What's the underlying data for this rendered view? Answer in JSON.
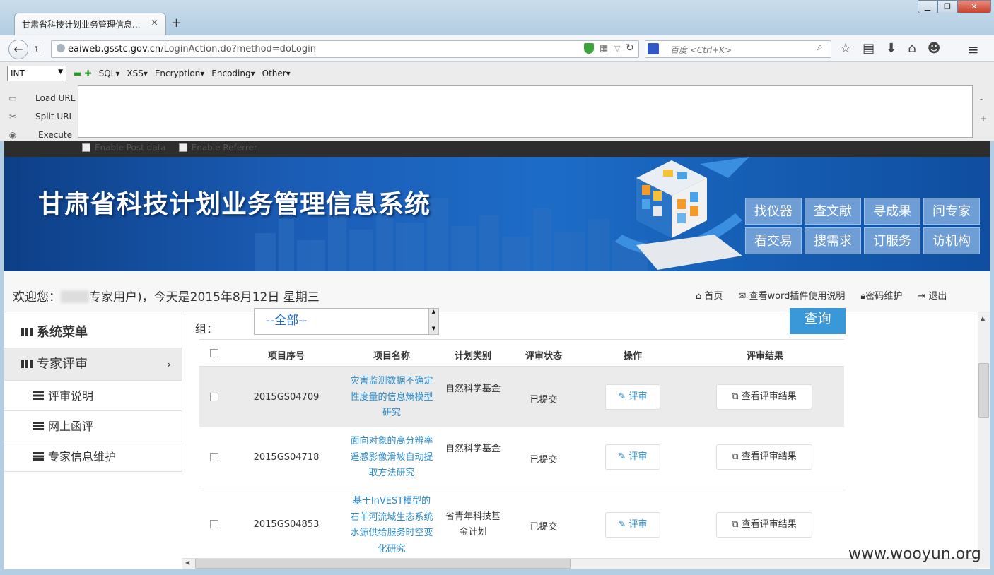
{
  "browser": {
    "tab_title": "甘肃省科技计划业务管理信息...",
    "tab_close": "×",
    "new_tab": "+",
    "url_host": "eaiweb.gsstc.gov.cn",
    "url_path": "/LoginAction.do?method=doLogin",
    "search_placeholder": "百度 <Ctrl+K>",
    "window_buttons": [
      "▁",
      "❐",
      "✕"
    ]
  },
  "hackbar": {
    "select_value": "INT",
    "menus": [
      "SQL▾",
      "XSS▾",
      "Encryption▾",
      "Encoding▾",
      "Other▾"
    ],
    "actions": [
      "Load URL",
      "Split URL",
      "Execute"
    ],
    "side_marks": [
      "-",
      "+"
    ],
    "post_option": "Enable Post data",
    "referrer_option": "Enable Referrer"
  },
  "banner": {
    "title": "甘肃省科技计划业务管理信息系统",
    "nav": [
      "找仪器",
      "查文献",
      "寻成果",
      "问专家",
      "看交易",
      "搜需求",
      "订服务",
      "访机构"
    ]
  },
  "welcome": {
    "prefix": "欢迎您：",
    "suffix": "专家用户)，今天是2015年8月12日 星期三",
    "links": [
      "首页",
      "查看word插件使用说明",
      "密码维护",
      "退出"
    ]
  },
  "sidebar": {
    "title": "系统菜单",
    "section": "专家评审",
    "items": [
      "评审说明",
      "网上函评",
      "专家信息维护"
    ]
  },
  "filter": {
    "group_label": "组：",
    "group_value": "--全部--",
    "query_button": "查询"
  },
  "table": {
    "headers": [
      "项目序号",
      "项目名称",
      "计划类别",
      "评审状态",
      "操作",
      "评审结果"
    ],
    "rows": [
      {
        "id": "2015GS04709",
        "name": "灾害监测数据不确定性度量的信息熵模型研究",
        "type": "自然科学基金",
        "status": "已提交",
        "action": "评审",
        "result": "查看评审结果"
      },
      {
        "id": "2015GS04718",
        "name": "面向对象的高分辨率遥感影像滑坡自动提取方法研究",
        "type": "自然科学基金",
        "status": "已提交",
        "action": "评审",
        "result": "查看评审结果"
      },
      {
        "id": "2015GS04853",
        "name": "基于InVEST模型的石羊河流域生态系统水源供给服务时空变化研究",
        "type": "省青年科技基金计划",
        "status": "已提交",
        "action": "评审",
        "result": "查看评审结果"
      }
    ]
  },
  "watermark": "www.wooyun.org"
}
